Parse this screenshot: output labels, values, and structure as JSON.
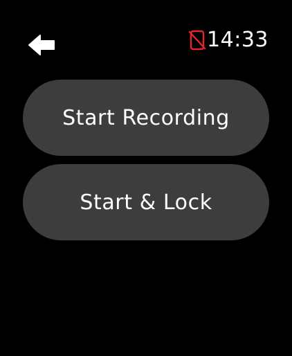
{
  "status_bar": {
    "time": "14:33",
    "icon": "phone-disconnected-icon",
    "icon_color": "#e5262b"
  },
  "navigation": {
    "back_icon": "back-arrow-icon"
  },
  "actions": {
    "start_recording_label": "Start Recording",
    "start_lock_label": "Start & Lock"
  },
  "colors": {
    "background": "#000000",
    "button_fill": "#3d3d3d",
    "text": "#ffffff",
    "alert": "#e5262b"
  }
}
